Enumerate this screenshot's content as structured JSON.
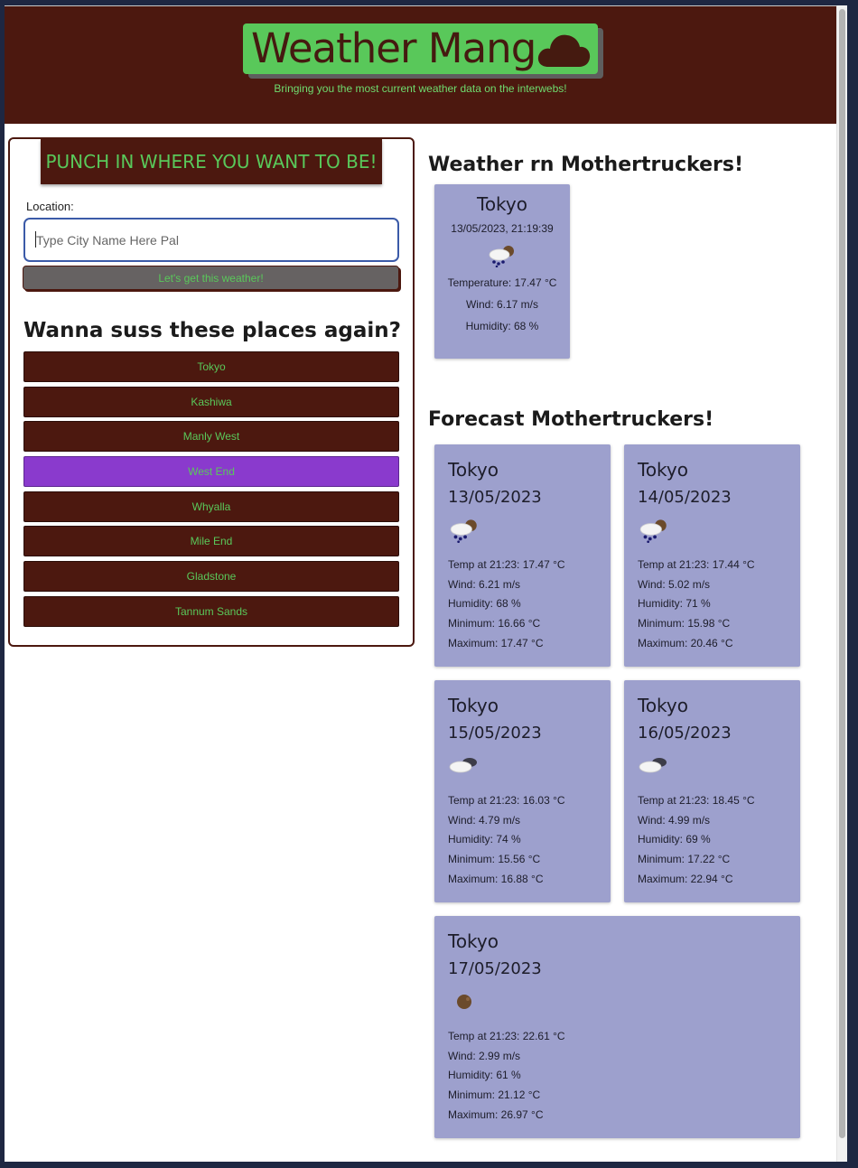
{
  "header": {
    "title": "Weather Mang",
    "tagline": "Bringing you the most current weather data on the interwebs!",
    "icon": "cloud-icon"
  },
  "search": {
    "heading": "PUNCH IN WHERE YOU WANT TO BE!",
    "label": "Location:",
    "placeholder": "Type City Name Here Pal",
    "button": "Let's get this weather!"
  },
  "history": {
    "title": "Wanna suss these places again?",
    "items": [
      "Tokyo",
      "Kashiwa",
      "Manly West",
      "West End",
      "Whyalla",
      "Mile End",
      "Gladstone",
      "Tannum Sands"
    ],
    "active_index": 3
  },
  "current": {
    "heading": "Weather rn Mothertruckers!",
    "city": "Tokyo",
    "datetime": "13/05/2023, 21:19:39",
    "icon": "rain-cloud-icon",
    "temperature": "Temperature: 17.47 °C",
    "wind": "Wind: 6.17 m/s",
    "humidity": "Humidity: 68 %"
  },
  "forecast": {
    "heading": "Forecast Mothertruckers!",
    "days": [
      {
        "city": "Tokyo",
        "date": "13/05/2023",
        "icon": "rain-cloud-icon",
        "temp": "Temp at 21:23: 17.47 °C",
        "wind": "Wind: 6.21 m/s",
        "humidity": "Humidity: 68 %",
        "min": "Minimum: 16.66 °C",
        "max": "Maximum: 17.47 °C"
      },
      {
        "city": "Tokyo",
        "date": "14/05/2023",
        "icon": "rain-cloud-icon",
        "temp": "Temp at 21:23: 17.44 °C",
        "wind": "Wind: 5.02 m/s",
        "humidity": "Humidity: 71 %",
        "min": "Minimum: 15.98 °C",
        "max": "Maximum: 20.46 °C"
      },
      {
        "city": "Tokyo",
        "date": "15/05/2023",
        "icon": "cloud-icon",
        "temp": "Temp at 21:23: 16.03 °C",
        "wind": "Wind: 4.79 m/s",
        "humidity": "Humidity: 74 %",
        "min": "Minimum: 15.56 °C",
        "max": "Maximum: 16.88 °C"
      },
      {
        "city": "Tokyo",
        "date": "16/05/2023",
        "icon": "cloud-icon",
        "temp": "Temp at 21:23: 18.45 °C",
        "wind": "Wind: 4.99 m/s",
        "humidity": "Humidity: 69 %",
        "min": "Minimum: 17.22 °C",
        "max": "Maximum: 22.94 °C"
      },
      {
        "city": "Tokyo",
        "date": "17/05/2023",
        "icon": "moon-icon",
        "temp": "Temp at 21:23: 22.61 °C",
        "wind": "Wind: 2.99 m/s",
        "humidity": "Humidity: 61 %",
        "min": "Minimum: 21.12 °C",
        "max": "Maximum: 26.97 °C"
      }
    ]
  },
  "colors": {
    "header_bg": "#4c180f",
    "brand_green": "#59c85a",
    "card_bg": "#9da0cd",
    "active_history": "#8a3acd"
  }
}
